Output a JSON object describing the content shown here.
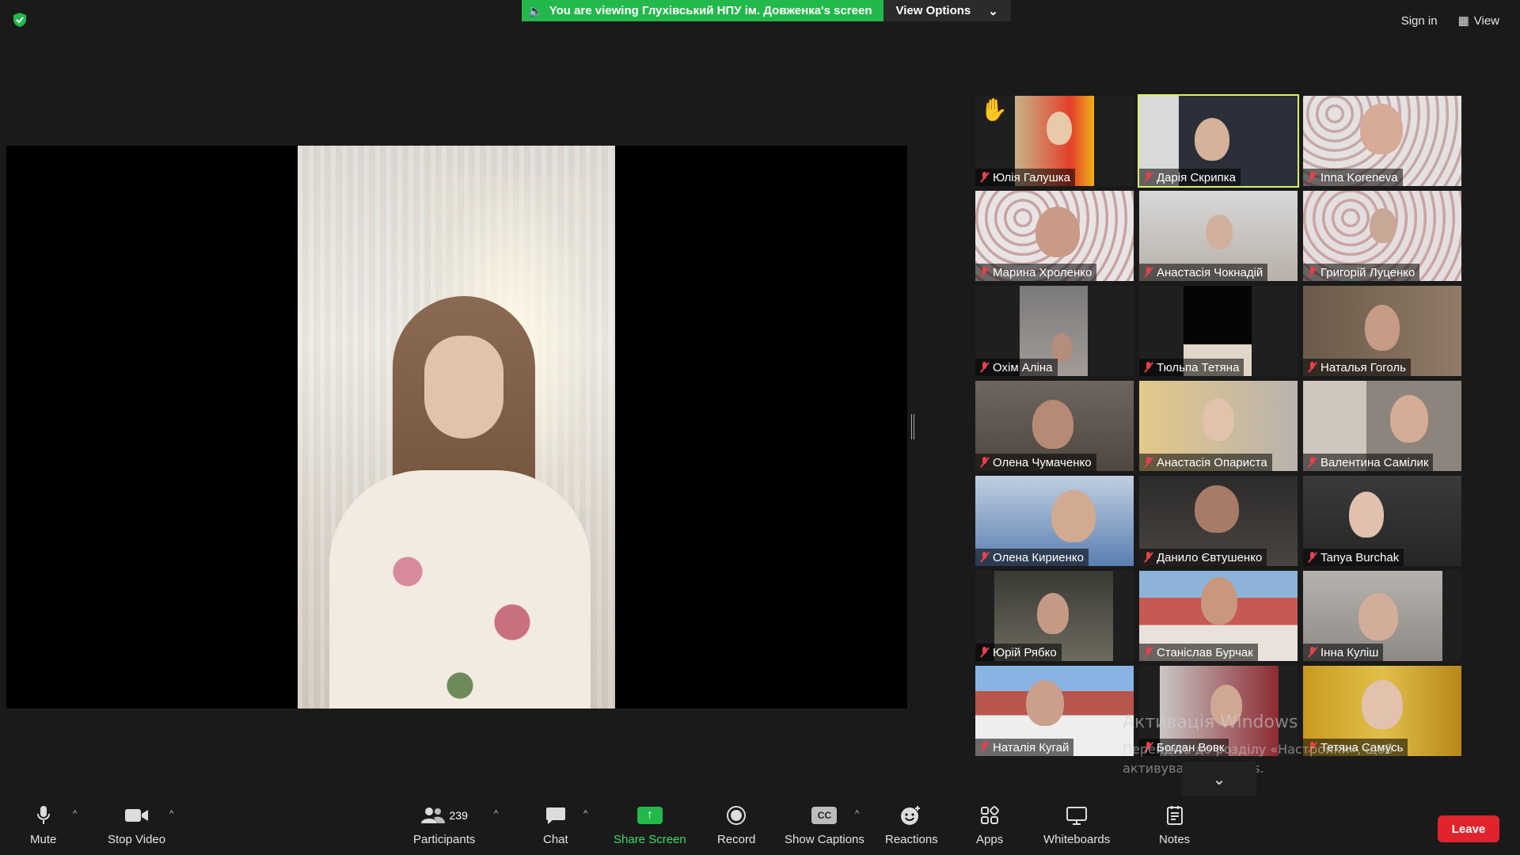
{
  "top": {
    "banner_text": "You are viewing Глухівський НПУ ім. Довженка's screen",
    "view_options": "View Options",
    "sign_in": "Sign in",
    "view": "View"
  },
  "gallery": [
    {
      "name": "Юлія Галушка",
      "raised_hand": true,
      "active": false
    },
    {
      "name": "Дарія Скрипка",
      "raised_hand": false,
      "active": true
    },
    {
      "name": "Inna Koreneva",
      "raised_hand": false,
      "active": false
    },
    {
      "name": "Марина Хроленко",
      "raised_hand": false,
      "active": false
    },
    {
      "name": "Анастасія Чокнадій",
      "raised_hand": false,
      "active": false
    },
    {
      "name": "Григорій Луценко",
      "raised_hand": false,
      "active": false
    },
    {
      "name": "Охім Аліна",
      "raised_hand": false,
      "active": false
    },
    {
      "name": "Тюльпа Тетяна",
      "raised_hand": false,
      "active": false
    },
    {
      "name": "Наталья Гоголь",
      "raised_hand": false,
      "active": false
    },
    {
      "name": "Олена Чумаченко",
      "raised_hand": false,
      "active": false
    },
    {
      "name": "Анастасія Опариста",
      "raised_hand": false,
      "active": false
    },
    {
      "name": "Валентина Самілик",
      "raised_hand": false,
      "active": false
    },
    {
      "name": "Олена Кириенко",
      "raised_hand": false,
      "active": false
    },
    {
      "name": "Данило Євтушенко",
      "raised_hand": false,
      "active": false
    },
    {
      "name": "Tanya Burchak",
      "raised_hand": false,
      "active": false
    },
    {
      "name": "Юрій Рябко",
      "raised_hand": false,
      "active": false
    },
    {
      "name": "Станіслав Бурчак",
      "raised_hand": false,
      "active": false
    },
    {
      "name": "Інна Куліш",
      "raised_hand": false,
      "active": false
    },
    {
      "name": "Наталія Кугай",
      "raised_hand": false,
      "active": false
    },
    {
      "name": "Богдан Вовк",
      "raised_hand": false,
      "active": false
    },
    {
      "name": "Тетяна Самусь",
      "raised_hand": false,
      "active": false
    }
  ],
  "watermark": {
    "title": "Активація Windows",
    "subtitle": "Перейдіть до розділу «Настройки», щоб активувати Windows."
  },
  "toolbar": {
    "mute": "Mute",
    "stop_video": "Stop Video",
    "participants": "Participants",
    "participants_count": "239",
    "chat": "Chat",
    "share_screen": "Share Screen",
    "record": "Record",
    "show_captions": "Show Captions",
    "cc": "CC",
    "reactions": "Reactions",
    "apps": "Apps",
    "whiteboards": "Whiteboards",
    "notes": "Notes",
    "leave": "Leave"
  },
  "colors": {
    "banner_green": "#23b84b",
    "leave_red": "#e0242e",
    "active_speaker": "#d9f266",
    "muted_red": "#e8404a"
  }
}
